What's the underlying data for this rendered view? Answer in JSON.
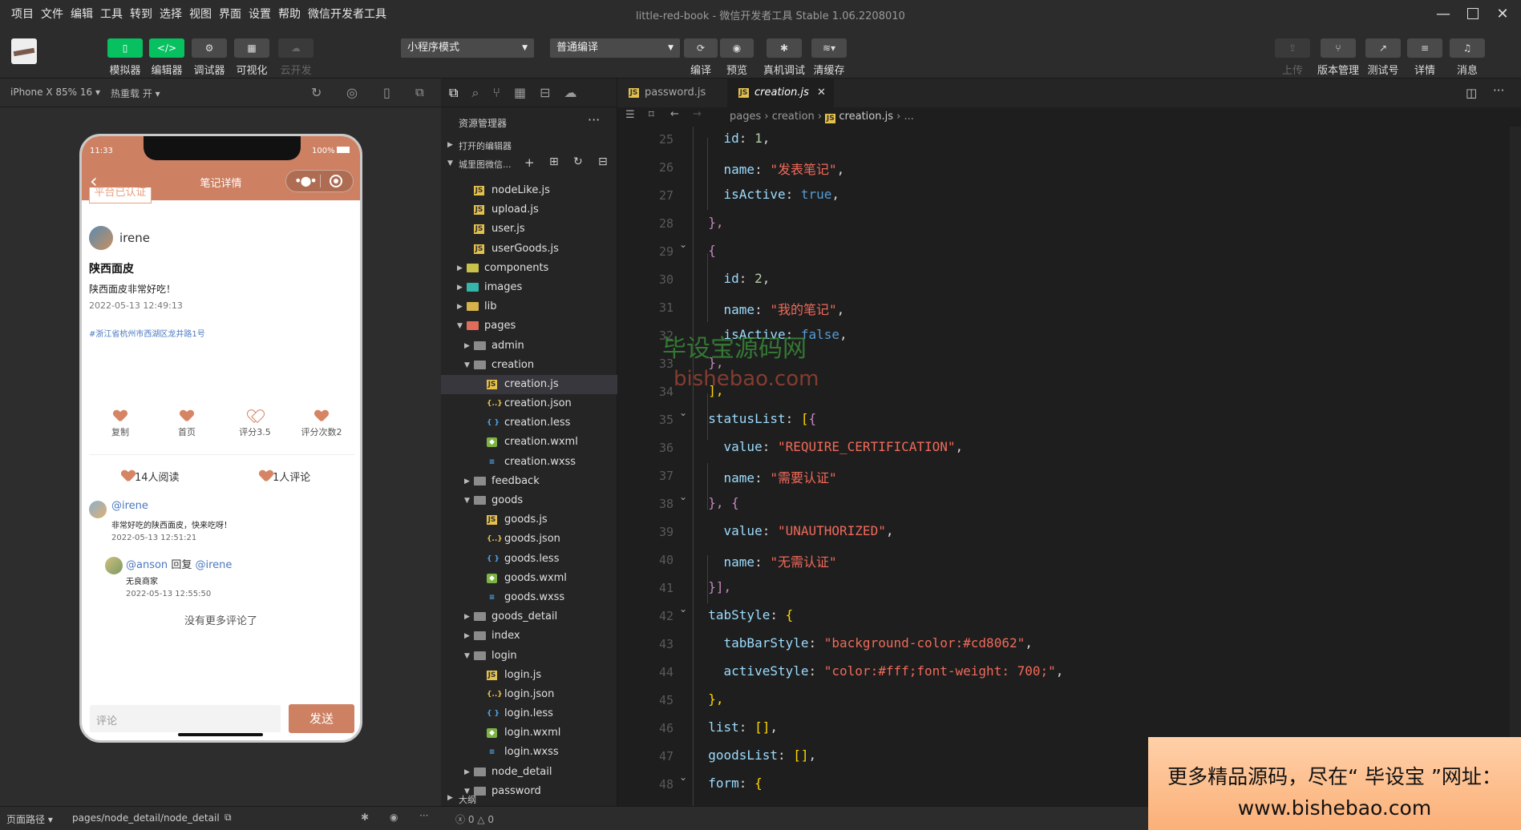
{
  "menu": {
    "items": [
      "项目",
      "文件",
      "编辑",
      "工具",
      "转到",
      "选择",
      "视图",
      "界面",
      "设置",
      "帮助",
      "微信开发者工具"
    ],
    "window_title": "little-red-book - 微信开发者工具 Stable 1.06.2208010"
  },
  "toolbar": {
    "simulator": "模拟器",
    "editor": "编辑器",
    "debugger": "调试器",
    "visual": "可视化",
    "cloud": "云开发",
    "mode_select": "小程序模式",
    "compile_select": "普通编译",
    "compile": "编译",
    "preview": "预览",
    "remote_debug": "真机调试",
    "clear_cache": "清缓存",
    "upload": "上传",
    "version": "版本管理",
    "test": "测试号",
    "details": "详情",
    "messages": "消息"
  },
  "simulator": {
    "device": "iPhone X 85% 16",
    "hot_reload": "热重载 开",
    "status_time": "11:33",
    "battery": "100%",
    "nav_title": "笔记详情",
    "badge": "平台已认证",
    "author": "irene",
    "post_title": "陕西面皮",
    "post_body": "陕西面皮非常好吃！",
    "post_time": "2022-05-13 12:49:13",
    "location": "#浙江省杭州市西湖区龙井路1号",
    "actions": [
      "复制",
      "首页",
      "评分3.5",
      "评分次数2"
    ],
    "reads": "14人阅读",
    "comments_count": "1人评论",
    "comments": [
      {
        "user": "@irene",
        "text": "非常好吃的陕西面皮，快来吃呀！",
        "time": "2022-05-13 12:51:21"
      },
      {
        "user": "@anson",
        "reply": "回复",
        "target": "@irene",
        "text": "无良商家",
        "time": "2022-05-13 12:55:50"
      }
    ],
    "no_more": "没有更多评论了",
    "comment_placeholder": "评论",
    "send": "发送"
  },
  "explorer": {
    "title": "资源管理器",
    "open_editors": "打开的编辑器",
    "project": "城里图微信...",
    "outline": "大纲",
    "files": [
      {
        "name": "nodeLike.js",
        "type": "js",
        "depth": 2
      },
      {
        "name": "upload.js",
        "type": "js",
        "depth": 2
      },
      {
        "name": "user.js",
        "type": "js",
        "depth": 2
      },
      {
        "name": "userGoods.js",
        "type": "js",
        "depth": 2
      },
      {
        "name": "components",
        "type": "folder",
        "color": "comp",
        "depth": 1,
        "state": "closed"
      },
      {
        "name": "images",
        "type": "folder",
        "color": "teal",
        "depth": 1,
        "state": "closed"
      },
      {
        "name": "lib",
        "type": "folder",
        "color": "yel",
        "depth": 1,
        "state": "closed"
      },
      {
        "name": "pages",
        "type": "folder",
        "color": "red",
        "depth": 1,
        "state": "open"
      },
      {
        "name": "admin",
        "type": "folder",
        "depth": 2,
        "state": "closed"
      },
      {
        "name": "creation",
        "type": "folder",
        "depth": 2,
        "state": "open"
      },
      {
        "name": "creation.js",
        "type": "js",
        "depth": 3,
        "selected": true
      },
      {
        "name": "creation.json",
        "type": "json",
        "depth": 3
      },
      {
        "name": "creation.less",
        "type": "less",
        "depth": 3
      },
      {
        "name": "creation.wxml",
        "type": "wxml",
        "depth": 3
      },
      {
        "name": "creation.wxss",
        "type": "wxss",
        "depth": 3
      },
      {
        "name": "feedback",
        "type": "folder",
        "depth": 2,
        "state": "closed"
      },
      {
        "name": "goods",
        "type": "folder",
        "depth": 2,
        "state": "open"
      },
      {
        "name": "goods.js",
        "type": "js",
        "depth": 3
      },
      {
        "name": "goods.json",
        "type": "json",
        "depth": 3
      },
      {
        "name": "goods.less",
        "type": "less",
        "depth": 3
      },
      {
        "name": "goods.wxml",
        "type": "wxml",
        "depth": 3
      },
      {
        "name": "goods.wxss",
        "type": "wxss",
        "depth": 3
      },
      {
        "name": "goods_detail",
        "type": "folder",
        "depth": 2,
        "state": "closed"
      },
      {
        "name": "index",
        "type": "folder",
        "depth": 2,
        "state": "closed"
      },
      {
        "name": "login",
        "type": "folder",
        "depth": 2,
        "state": "open"
      },
      {
        "name": "login.js",
        "type": "js",
        "depth": 3
      },
      {
        "name": "login.json",
        "type": "json",
        "depth": 3
      },
      {
        "name": "login.less",
        "type": "less",
        "depth": 3
      },
      {
        "name": "login.wxml",
        "type": "wxml",
        "depth": 3
      },
      {
        "name": "login.wxss",
        "type": "wxss",
        "depth": 3
      },
      {
        "name": "node_detail",
        "type": "folder",
        "depth": 2,
        "state": "closed"
      },
      {
        "name": "password",
        "type": "folder",
        "depth": 2,
        "state": "open"
      }
    ]
  },
  "editor": {
    "tabs": [
      {
        "name": "password.js",
        "active": false
      },
      {
        "name": "creation.js",
        "active": true
      }
    ],
    "breadcrumb": [
      "pages",
      "creation",
      "creation.js",
      "..."
    ],
    "lines": [
      {
        "n": 25,
        "fold": false
      },
      {
        "n": 26,
        "fold": false
      },
      {
        "n": 27,
        "fold": false
      },
      {
        "n": 28,
        "fold": false
      },
      {
        "n": 29,
        "fold": true
      },
      {
        "n": 30,
        "fold": false
      },
      {
        "n": 31,
        "fold": false
      },
      {
        "n": 32,
        "fold": false
      },
      {
        "n": 33,
        "fold": false
      },
      {
        "n": 34,
        "fold": false
      },
      {
        "n": 35,
        "fold": true
      },
      {
        "n": 36,
        "fold": false
      },
      {
        "n": 37,
        "fold": false
      },
      {
        "n": 38,
        "fold": true
      },
      {
        "n": 39,
        "fold": false
      },
      {
        "n": 40,
        "fold": false
      },
      {
        "n": 41,
        "fold": false
      },
      {
        "n": 42,
        "fold": true
      },
      {
        "n": 43,
        "fold": false
      },
      {
        "n": 44,
        "fold": false
      },
      {
        "n": 45,
        "fold": false
      },
      {
        "n": 46,
        "fold": false
      },
      {
        "n": 47,
        "fold": false
      },
      {
        "n": 48,
        "fold": true
      }
    ],
    "code": {
      "l25": {
        "key": "id",
        "val": "1"
      },
      "l26": {
        "key": "name",
        "val": "\"发表笔记\""
      },
      "l27": {
        "key": "isActive",
        "val": "true"
      },
      "l28": "},",
      "l29": "{",
      "l30": {
        "key": "id",
        "val": "2"
      },
      "l31": {
        "key": "name",
        "val": "\"我的笔记\""
      },
      "l32": {
        "key": "isActive",
        "val": "false"
      },
      "l33": "},",
      "l34": "],",
      "l35": {
        "key": "statusList"
      },
      "l36": {
        "key": "value",
        "val": "\"REQUIRE_CERTIFICATION\""
      },
      "l37": {
        "key": "name",
        "val": "\"需要认证\""
      },
      "l38": "}, {",
      "l39": {
        "key": "value",
        "val": "\"UNAUTHORIZED\""
      },
      "l40": {
        "key": "name",
        "val": "\"无需认证\""
      },
      "l41": "}],",
      "l42": {
        "key": "tabStyle"
      },
      "l43": {
        "key": "tabBarStyle",
        "val": "\"background-color:#cd8062\""
      },
      "l44": {
        "key": "activeStyle",
        "val": "\"color:#fff;font-weight: 700;\""
      },
      "l45": "},",
      "l46": {
        "key": "list",
        "val": "[]"
      },
      "l47": {
        "key": "goodsList",
        "val": "[]"
      },
      "l48": {
        "key": "form"
      }
    }
  },
  "watermark": {
    "cn": "毕设宝源码网",
    "en": "bishebao.com"
  },
  "promo": {
    "line1": "更多精品源码，尽在“ 毕设宝 ”网址：",
    "line2": "www.bishebao.com"
  },
  "statusbar": {
    "page_path_label": "页面路径",
    "page_path": "pages/node_detail/node_detail",
    "errors": "0",
    "warnings": "0"
  },
  "colors": {
    "accent": "#cd8062",
    "green": "#07c160",
    "heart": "#d58564"
  }
}
